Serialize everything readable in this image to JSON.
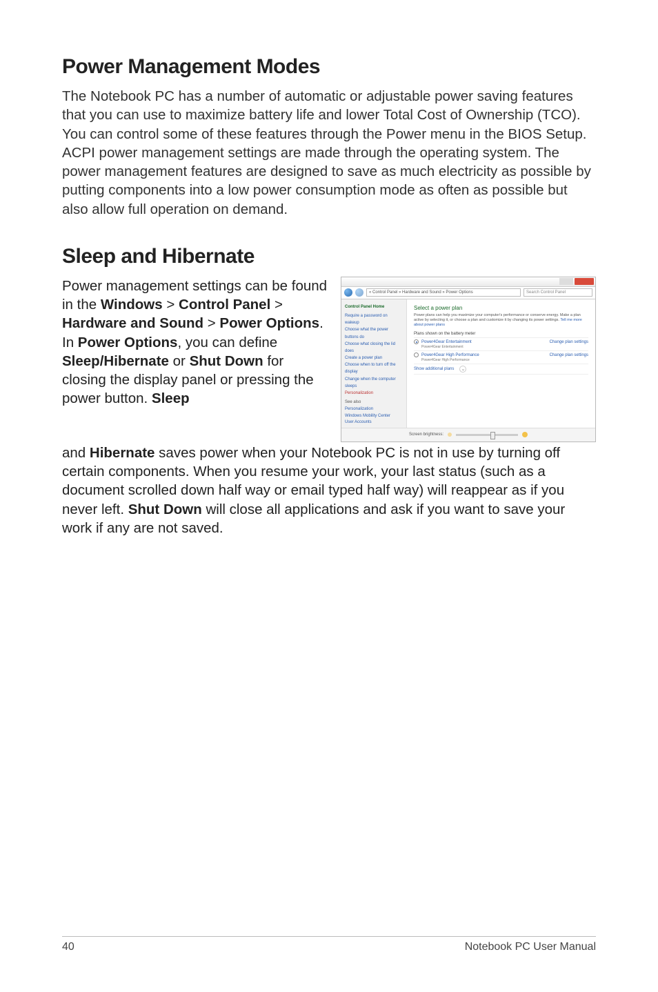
{
  "section1": {
    "heading": "Power Management Modes",
    "body": "The Notebook PC has a number of automatic or adjustable power saving features that you can use to maximize battery life and lower Total Cost of Ownership (TCO). You can control some of these features through the Power menu in the BIOS Setup. ACPI power management settings are made through the operating system. The power management features are designed to save as much electricity as possible by putting components into a low power consumption mode as often as possible but also allow full operation on demand."
  },
  "section2": {
    "heading": "Sleep and Hibernate",
    "left_pre": "Power management settings can be found in the ",
    "windows": "Windows",
    "gt1": " > ",
    "control_panel": "Control Panel",
    "gt2": " > ",
    "hw_sound": "Hardware and Sound",
    "gt3": " > ",
    "power_opts": "Power Options",
    "after_power_opts": ". In ",
    "power_opts2": "Power Options",
    "after_po2": ", you can define ",
    "sleep_hib": "Sleep/Hibernate",
    "or": " or ",
    "shut_down": "Shut Down",
    "tail1": " for closing the display panel or pressing the power button. ",
    "sleep": "Sleep",
    "below_and": "and ",
    "hibernate": "Hibernate",
    "below_mid": " saves power when your Notebook PC is not in use by turning off certain components. When you resume your work, your last status (such as a document scrolled down half way or email typed half way) will reappear as if you never left. ",
    "shut_down2": "Shut Down",
    "below_tail": " will close all applications and ask if you want to save your work if any are not saved."
  },
  "shot": {
    "addr": " « Control Panel » Hardware and Sound » Power Options",
    "search": "Search Control Panel",
    "side_head": "Control Panel Home",
    "side1": "Require a password on wakeup",
    "side2": "Choose what the power buttons do",
    "side3": "Choose what closing the lid does",
    "side4": "Create a power plan",
    "side5": "Choose when to turn off the display",
    "side6": "Change when the computer sleeps",
    "side7": "Personalization",
    "sb_head": "See also",
    "sb1": "Personalization",
    "sb2": "Windows Mobility Center",
    "sb3": "User Accounts",
    "main_title": "Select a power plan",
    "main_desc1": "Power plans can help you maximize your computer's performance or conserve energy. Make a plan active by selecting it, or choose a plan and customize it by changing its power settings. ",
    "main_desc_link": "Tell me more about power plans",
    "plan_head": "Plans shown on the battery meter",
    "plan1": "Power4Gear Entertainment",
    "plan1_sub": "Power4Gear Entertainment",
    "plan2": "Power4Gear High Performance",
    "plan2_sub": "Power4Gear High Performance",
    "change": "Change plan settings",
    "show_add": "Show additional plans",
    "brightness": "Screen brightness:"
  },
  "footer": {
    "page": "40",
    "title": "Notebook PC User Manual"
  }
}
